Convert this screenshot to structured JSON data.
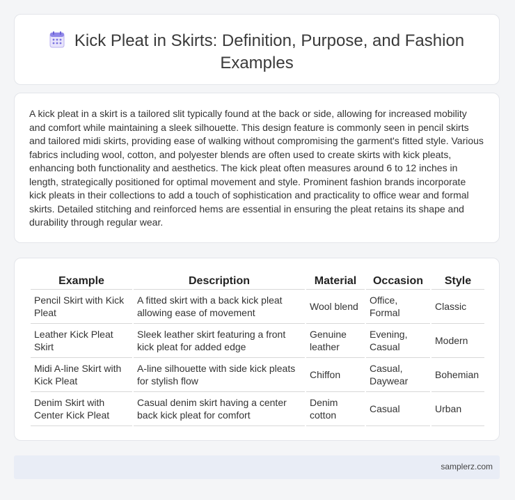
{
  "header": {
    "title": "Kick Pleat in Skirts: Definition, Purpose, and Fashion Examples",
    "icon": "calendar-icon"
  },
  "intro": {
    "text": "A kick pleat in a skirt is a tailored slit typically found at the back or side, allowing for increased mobility and comfort while maintaining a sleek silhouette. This design feature is commonly seen in pencil skirts and tailored midi skirts, providing ease of walking without compromising the garment's fitted style. Various fabrics including wool, cotton, and polyester blends are often used to create skirts with kick pleats, enhancing both functionality and aesthetics. The kick pleat often measures around 6 to 12 inches in length, strategically positioned for optimal movement and style. Prominent fashion brands incorporate kick pleats in their collections to add a touch of sophistication and practicality to office wear and formal skirts. Detailed stitching and reinforced hems are essential in ensuring the pleat retains its shape and durability through regular wear."
  },
  "table": {
    "headers": [
      "Example",
      "Description",
      "Material",
      "Occasion",
      "Style"
    ],
    "rows": [
      [
        "Pencil Skirt with Kick Pleat",
        "A fitted skirt with a back kick pleat allowing ease of movement",
        "Wool blend",
        "Office, Formal",
        "Classic"
      ],
      [
        "Leather Kick Pleat Skirt",
        "Sleek leather skirt featuring a front kick pleat for added edge",
        "Genuine leather",
        "Evening, Casual",
        "Modern"
      ],
      [
        "Midi A-line Skirt with Kick Pleat",
        "A-line silhouette with side kick pleats for stylish flow",
        "Chiffon",
        "Casual, Daywear",
        "Bohemian"
      ],
      [
        "Denim Skirt with Center Kick Pleat",
        "Casual denim skirt having a center back kick pleat for comfort",
        "Denim cotton",
        "Casual",
        "Urban"
      ]
    ]
  },
  "footer": {
    "text": "samplerz.com"
  }
}
